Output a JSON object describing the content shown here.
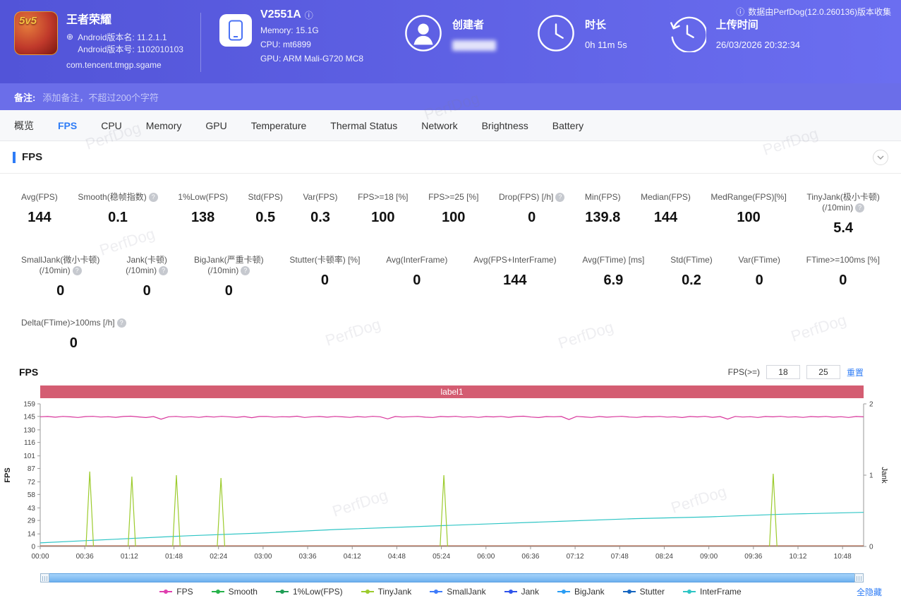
{
  "header": {
    "game": {
      "title": "王者荣耀",
      "android_version_name": "Android版本名: 11.2.1.1",
      "android_version_code": "Android版本号: 1102010103",
      "package": "com.tencent.tmgp.sgame",
      "icon_text": "5v5"
    },
    "device": {
      "model": "V2551A",
      "memory": "Memory: 15.1G",
      "cpu": "CPU: mt6899",
      "gpu": "GPU: ARM Mali-G720 MC8"
    },
    "creator": {
      "label": "创建者"
    },
    "duration": {
      "label": "时长",
      "value": "0h 11m 5s"
    },
    "upload": {
      "label": "上传时间",
      "value": "26/03/2026 20:32:34"
    },
    "collect_info": "数据由PerfDog(12.0.260136)版本收集"
  },
  "note": {
    "label": "备注:",
    "placeholder": "添加备注，不超过200个字符"
  },
  "tabs": [
    {
      "label": "概览",
      "active": false
    },
    {
      "label": "FPS",
      "active": true
    },
    {
      "label": "CPU",
      "active": false
    },
    {
      "label": "Memory",
      "active": false
    },
    {
      "label": "GPU",
      "active": false
    },
    {
      "label": "Temperature",
      "active": false
    },
    {
      "label": "Thermal Status",
      "active": false
    },
    {
      "label": "Network",
      "active": false
    },
    {
      "label": "Brightness",
      "active": false
    },
    {
      "label": "Battery",
      "active": false
    }
  ],
  "section": {
    "title": "FPS"
  },
  "stats": {
    "row1": [
      {
        "label": "Avg(FPS)",
        "value": "144"
      },
      {
        "label": "Smooth(稳帧指数)",
        "info": true,
        "value": "0.1"
      },
      {
        "label": "1%Low(FPS)",
        "value": "138"
      },
      {
        "label": "Std(FPS)",
        "value": "0.5"
      },
      {
        "label": "Var(FPS)",
        "value": "0.3"
      },
      {
        "label": "FPS>=18 [%]",
        "value": "100"
      },
      {
        "label": "FPS>=25 [%]",
        "value": "100"
      },
      {
        "label": "Drop(FPS) [/h]",
        "info": true,
        "value": "0"
      },
      {
        "label": "Min(FPS)",
        "value": "139.8"
      },
      {
        "label": "Median(FPS)",
        "value": "144"
      },
      {
        "label": "MedRange(FPS)[%]",
        "value": "100"
      },
      {
        "label": "TinyJank(极小卡顿)",
        "label2": "(/10min)",
        "info": true,
        "value": "5.4"
      }
    ],
    "row2": [
      {
        "label": "SmallJank(微小卡顿)",
        "label2": "(/10min)",
        "info": true,
        "value": "0"
      },
      {
        "label": "Jank(卡顿)",
        "label2": "(/10min)",
        "info": true,
        "value": "0"
      },
      {
        "label": "BigJank(严重卡顿)",
        "label2": "(/10min)",
        "info": true,
        "value": "0"
      },
      {
        "label": "Stutter(卡顿率) [%]",
        "value": "0"
      },
      {
        "label": "Avg(InterFrame)",
        "value": "0"
      },
      {
        "label": "Avg(FPS+InterFrame)",
        "value": "144"
      },
      {
        "label": "Avg(FTime) [ms]",
        "value": "6.9"
      },
      {
        "label": "Std(FTime)",
        "value": "0.2"
      },
      {
        "label": "Var(FTime)",
        "value": "0"
      },
      {
        "label": "FTime>=100ms [%]",
        "value": "0"
      }
    ],
    "row3": [
      {
        "label": "Delta(FTime)>100ms [/h]",
        "info": true,
        "value": "0"
      }
    ]
  },
  "fps_filter": {
    "label": "FPS(>=)",
    "low": "18",
    "high": "25",
    "reset": "重置"
  },
  "chart_data": {
    "type": "line",
    "title": "FPS",
    "band_label": "label1",
    "x_max_seconds": 665,
    "x_tick_interval_seconds": 36,
    "x_ticks": [
      "00:00",
      "00:36",
      "01:12",
      "01:48",
      "02:24",
      "03:00",
      "03:36",
      "04:12",
      "04:48",
      "05:24",
      "06:00",
      "06:36",
      "07:12",
      "07:48",
      "08:24",
      "09:00",
      "09:36",
      "10:12",
      "10:48"
    ],
    "y_left": {
      "label": "FPS",
      "max": 159,
      "ticks": [
        0,
        14,
        29,
        43,
        58,
        72,
        87,
        101,
        116,
        130,
        145,
        159
      ]
    },
    "y_right": {
      "label": "Jank",
      "max": 2,
      "ticks": [
        0,
        1,
        2
      ]
    },
    "series": [
      {
        "name": "zero-baseline",
        "color": "#b05a3c",
        "axis": "left",
        "baseline": 0.8
      },
      {
        "name": "InterFrame",
        "color": "#2fc5c5",
        "axis": "left",
        "points": [
          [
            0,
            4
          ],
          [
            60,
            8
          ],
          [
            120,
            12
          ],
          [
            180,
            15
          ],
          [
            240,
            19
          ],
          [
            300,
            22
          ],
          [
            360,
            25
          ],
          [
            420,
            28
          ],
          [
            480,
            31
          ],
          [
            540,
            33
          ],
          [
            600,
            36
          ],
          [
            665,
            38
          ]
        ]
      },
      {
        "name": "TinyJank",
        "color": "#9ccb2d",
        "axis": "right",
        "spikes": [
          [
            40,
            1.05
          ],
          [
            74,
            0.98
          ],
          [
            110,
            1.0
          ],
          [
            146,
            0.96
          ],
          [
            326,
            1.0
          ],
          [
            592,
            1.02
          ]
        ]
      },
      {
        "name": "FPS",
        "color": "#d8359b",
        "axis": "left",
        "values": [
          144.6,
          144.9,
          144.1,
          145.0,
          144.5,
          143.8,
          144.8,
          145.1,
          144.3,
          144.7,
          144.0,
          144.9,
          145.2,
          144.4,
          143.7,
          144.8,
          141.9,
          144.6,
          145.0,
          144.2,
          144.7,
          143.9,
          144.9,
          144.3,
          145.1,
          144.6,
          144.0,
          144.8,
          143.6,
          144.9,
          145.0,
          144.2,
          144.7,
          144.4,
          145.2,
          143.8,
          144.6,
          144.9,
          144.1,
          145.0,
          144.5,
          143.9,
          144.8,
          144.2,
          145.1,
          144.6,
          142.2,
          144.9,
          144.3,
          144.7,
          145.0,
          144.1,
          143.8,
          144.9,
          144.5,
          145.1,
          144.2,
          144.7,
          143.9,
          144.8,
          144.4,
          145.0,
          144.0,
          144.9,
          145.2,
          144.3,
          143.7,
          144.8,
          144.6,
          144.9,
          141.5,
          145.0,
          144.4,
          143.8,
          144.9,
          144.1,
          144.7,
          145.1,
          144.3,
          143.9,
          144.8,
          144.5,
          145.0,
          144.2,
          144.6,
          143.7,
          144.9,
          144.4,
          145.1,
          144.0,
          144.8,
          142.0,
          145.0,
          144.3,
          144.7,
          143.8,
          144.9,
          144.5,
          145.1,
          144.2,
          144.6,
          143.9,
          144.8,
          144.4,
          145.0,
          144.1,
          144.7,
          143.8,
          144.9,
          144.5
        ]
      }
    ]
  },
  "legend": [
    {
      "name": "FPS",
      "color": "#df3fae"
    },
    {
      "name": "Smooth",
      "color": "#27b24a"
    },
    {
      "name": "1%Low(FPS)",
      "color": "#1e9e55"
    },
    {
      "name": "TinyJank",
      "color": "#9ccb2d"
    },
    {
      "name": "SmallJank",
      "color": "#3e7bfa"
    },
    {
      "name": "Jank",
      "color": "#2f54eb"
    },
    {
      "name": "BigJank",
      "color": "#2a9df4"
    },
    {
      "name": "Stutter",
      "color": "#1565c0"
    },
    {
      "name": "InterFrame",
      "color": "#2fc5c5"
    }
  ],
  "hide_all": "全隐藏",
  "watermark": "PerfDog",
  "colors": {
    "accent": "#2e7cf6",
    "header": "#5254d8",
    "band": "#d45d72"
  }
}
